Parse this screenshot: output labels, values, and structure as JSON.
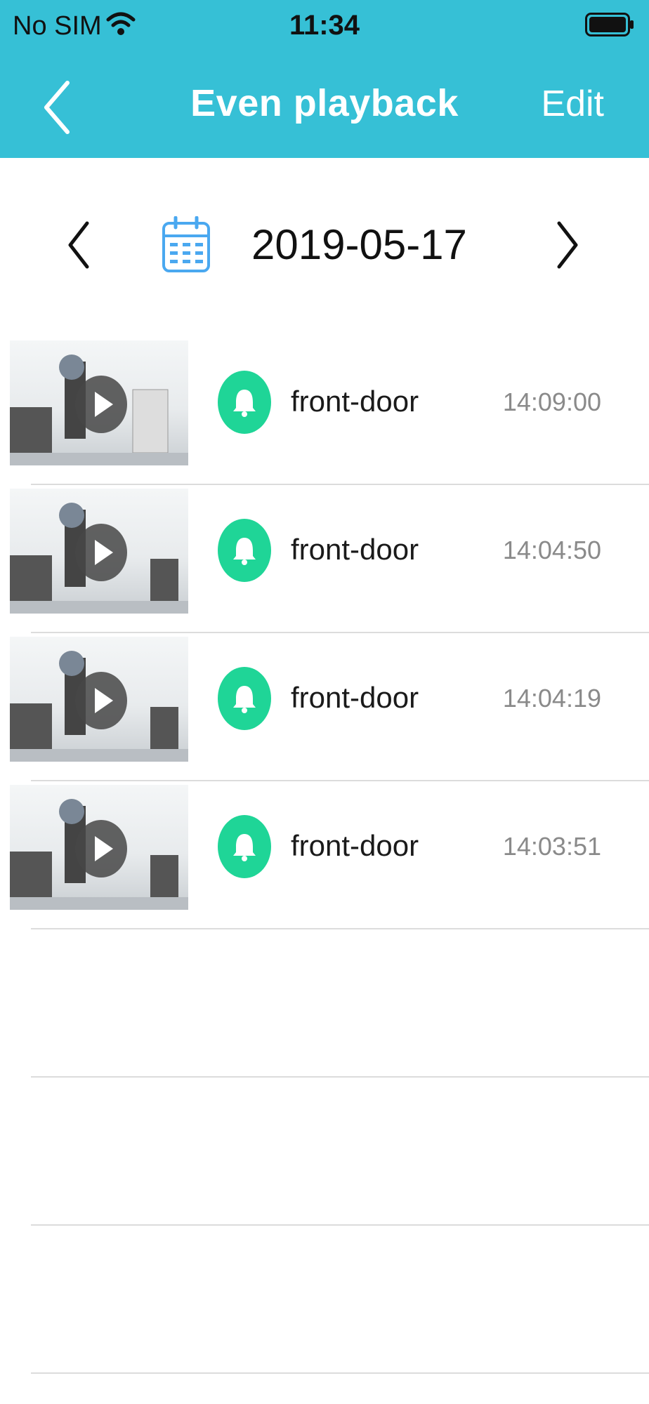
{
  "status_bar": {
    "carrier": "No SIM",
    "time": "11:34",
    "wifi_icon": "wifi-icon",
    "battery_icon": "battery-icon"
  },
  "navbar": {
    "title": "Even playback",
    "back_icon": "chevron-left-icon",
    "edit_label": "Edit",
    "background": "#36c0d6"
  },
  "date_selector": {
    "date": "2019-05-17",
    "prev_icon": "chevron-left-icon",
    "next_icon": "chevron-right-icon",
    "calendar_icon": "calendar-icon",
    "calendar_color": "#4aa8f0"
  },
  "events": [
    {
      "device": "front-door",
      "time": "14:09:00",
      "icon": "bell-icon"
    },
    {
      "device": "front-door",
      "time": "14:04:50",
      "icon": "bell-icon"
    },
    {
      "device": "front-door",
      "time": "14:04:19",
      "icon": "bell-icon"
    },
    {
      "device": "front-door",
      "time": "14:03:51",
      "icon": "bell-icon"
    }
  ],
  "colors": {
    "alarm_badge": "#1fd597",
    "time_text": "#8a8a8a",
    "divider": "#dcdcdc"
  }
}
